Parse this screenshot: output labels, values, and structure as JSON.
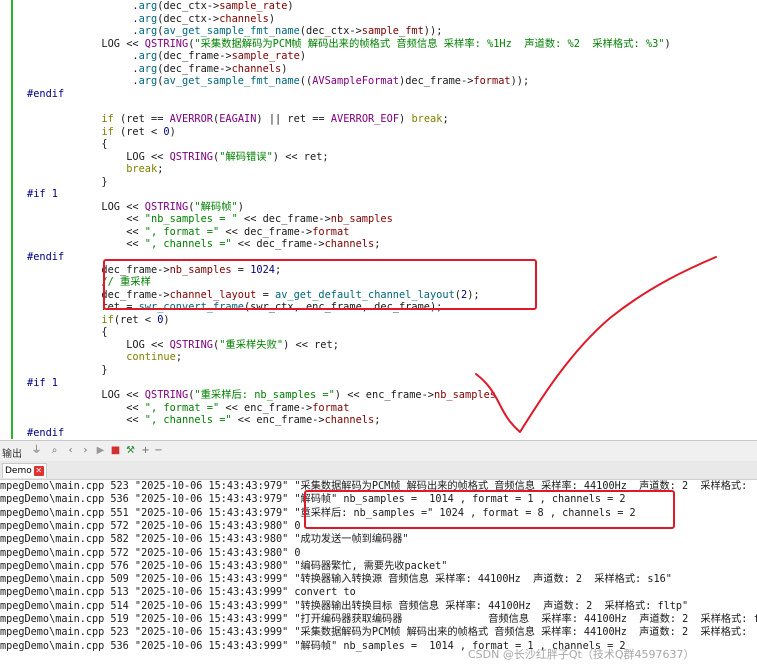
{
  "editor": {
    "lines": [
      [
        {
          "t": "                 ."
        },
        {
          "t": "arg",
          "c": "fn"
        },
        {
          "t": "(dec_ctx->"
        },
        {
          "t": "sample_rate",
          "c": "mem"
        },
        {
          "t": ")"
        }
      ],
      [
        {
          "t": "                 ."
        },
        {
          "t": "arg",
          "c": "fn"
        },
        {
          "t": "(dec_ctx->"
        },
        {
          "t": "channels",
          "c": "mem"
        },
        {
          "t": ")"
        }
      ],
      [
        {
          "t": "                 ."
        },
        {
          "t": "arg",
          "c": "fn"
        },
        {
          "t": "("
        },
        {
          "t": "av_get_sample_fmt_name",
          "c": "fn"
        },
        {
          "t": "(dec_ctx->"
        },
        {
          "t": "sample_fmt",
          "c": "mem"
        },
        {
          "t": "));"
        }
      ],
      [
        {
          "t": "            LOG << "
        },
        {
          "t": "QSTRING",
          "c": "mac"
        },
        {
          "t": "("
        },
        {
          "t": "\"采集数据解码为PCM帧 解码出来的帧格式 音频信息 采样率: %1Hz  声道数: %2  采样格式: %3\"",
          "c": "str"
        },
        {
          "t": ")"
        }
      ],
      [
        {
          "t": "                 ."
        },
        {
          "t": "arg",
          "c": "fn"
        },
        {
          "t": "(dec_frame->"
        },
        {
          "t": "sample_rate",
          "c": "mem"
        },
        {
          "t": ")"
        }
      ],
      [
        {
          "t": "                 ."
        },
        {
          "t": "arg",
          "c": "fn"
        },
        {
          "t": "(dec_frame->"
        },
        {
          "t": "channels",
          "c": "mem"
        },
        {
          "t": ")"
        }
      ],
      [
        {
          "t": "                 ."
        },
        {
          "t": "arg",
          "c": "fn"
        },
        {
          "t": "("
        },
        {
          "t": "av_get_sample_fmt_name",
          "c": "fn"
        },
        {
          "t": "(("
        },
        {
          "t": "AVSampleFormat",
          "c": "mac"
        },
        {
          "t": ")dec_frame->"
        },
        {
          "t": "format",
          "c": "mem"
        },
        {
          "t": "));"
        }
      ],
      [
        {
          "t": "#endif",
          "c": "pp"
        }
      ],
      [
        {
          "t": ""
        }
      ],
      [
        {
          "t": "            "
        },
        {
          "t": "if",
          "c": "kw"
        },
        {
          "t": " (ret == "
        },
        {
          "t": "AVERROR",
          "c": "mac"
        },
        {
          "t": "("
        },
        {
          "t": "EAGAIN",
          "c": "mac"
        },
        {
          "t": ") || ret == "
        },
        {
          "t": "AVERROR_EOF",
          "c": "mac"
        },
        {
          "t": ") "
        },
        {
          "t": "break",
          "c": "kw"
        },
        {
          "t": ";"
        }
      ],
      [
        {
          "t": "            "
        },
        {
          "t": "if",
          "c": "kw"
        },
        {
          "t": " (ret < "
        },
        {
          "t": "0",
          "c": "num"
        },
        {
          "t": ")"
        }
      ],
      [
        {
          "t": "            {"
        }
      ],
      [
        {
          "t": "                LOG << "
        },
        {
          "t": "QSTRING",
          "c": "mac"
        },
        {
          "t": "("
        },
        {
          "t": "\"解码错误\"",
          "c": "str"
        },
        {
          "t": ") << ret;"
        }
      ],
      [
        {
          "t": "                "
        },
        {
          "t": "break",
          "c": "kw"
        },
        {
          "t": ";"
        }
      ],
      [
        {
          "t": "            }"
        }
      ],
      [
        {
          "t": "#if 1",
          "c": "pp"
        }
      ],
      [
        {
          "t": "            LOG << "
        },
        {
          "t": "QSTRING",
          "c": "mac"
        },
        {
          "t": "("
        },
        {
          "t": "\"解码帧\"",
          "c": "str"
        },
        {
          "t": ")"
        }
      ],
      [
        {
          "t": "                << "
        },
        {
          "t": "\"nb_samples = \"",
          "c": "str"
        },
        {
          "t": " << dec_frame->"
        },
        {
          "t": "nb_samples",
          "c": "mem"
        }
      ],
      [
        {
          "t": "                << "
        },
        {
          "t": "\", format =\"",
          "c": "str"
        },
        {
          "t": " << dec_frame->"
        },
        {
          "t": "format",
          "c": "mem"
        }
      ],
      [
        {
          "t": "                << "
        },
        {
          "t": "\", channels =\"",
          "c": "str"
        },
        {
          "t": " << dec_frame->"
        },
        {
          "t": "channels",
          "c": "mem"
        },
        {
          "t": ";"
        }
      ],
      [
        {
          "t": "#endif",
          "c": "pp"
        }
      ],
      [
        {
          "t": "            dec_frame->"
        },
        {
          "t": "nb_samples",
          "c": "mem"
        },
        {
          "t": " = "
        },
        {
          "t": "1024",
          "c": "num"
        },
        {
          "t": ";"
        }
      ],
      [
        {
          "t": "            "
        },
        {
          "t": "// 重采样",
          "c": "cmt"
        }
      ],
      [
        {
          "t": "            dec_frame->"
        },
        {
          "t": "channel_layout",
          "c": "mem"
        },
        {
          "t": " = "
        },
        {
          "t": "av_get_default_channel_layout",
          "c": "fn"
        },
        {
          "t": "("
        },
        {
          "t": "2",
          "c": "num"
        },
        {
          "t": ");"
        }
      ],
      [
        {
          "t": "            ret = "
        },
        {
          "t": "swr_convert_frame",
          "c": "fn"
        },
        {
          "t": "(swr_ctx, enc_frame, dec_frame);"
        }
      ],
      [
        {
          "t": "            "
        },
        {
          "t": "if",
          "c": "kw"
        },
        {
          "t": "(ret < "
        },
        {
          "t": "0",
          "c": "num"
        },
        {
          "t": ")"
        }
      ],
      [
        {
          "t": "            {"
        }
      ],
      [
        {
          "t": "                LOG << "
        },
        {
          "t": "QSTRING",
          "c": "mac"
        },
        {
          "t": "("
        },
        {
          "t": "\"重采样失败\"",
          "c": "str"
        },
        {
          "t": ") << ret;"
        }
      ],
      [
        {
          "t": "                "
        },
        {
          "t": "continue",
          "c": "kw"
        },
        {
          "t": ";"
        }
      ],
      [
        {
          "t": "            }"
        }
      ],
      [
        {
          "t": "#if 1",
          "c": "pp"
        }
      ],
      [
        {
          "t": "            LOG << "
        },
        {
          "t": "QSTRING",
          "c": "mac"
        },
        {
          "t": "("
        },
        {
          "t": "\"重采样后: nb_samples =\"",
          "c": "str"
        },
        {
          "t": ") << enc_frame->"
        },
        {
          "t": "nb_samples",
          "c": "mem"
        }
      ],
      [
        {
          "t": "                << "
        },
        {
          "t": "\", format =\"",
          "c": "str"
        },
        {
          "t": " << enc_frame->"
        },
        {
          "t": "format",
          "c": "mem"
        }
      ],
      [
        {
          "t": "                << "
        },
        {
          "t": "\", channels =\"",
          "c": "str"
        },
        {
          "t": " << enc_frame->"
        },
        {
          "t": "channels",
          "c": "mem"
        },
        {
          "t": ";"
        }
      ],
      [
        {
          "t": "#endif",
          "c": "pp"
        }
      ]
    ]
  },
  "output_panel": {
    "title": "输出",
    "toolbar_icons": [
      "filter-icon",
      "search-icon",
      "up-icon",
      "down-icon",
      "run-icon",
      "stop-icon",
      "build-icon",
      "add-icon",
      "remove-icon"
    ],
    "tab_label": "Demo",
    "lines": [
      "mpegDemo\\main.cpp 523 \"2025-10-06 15:43:43:979\" \"采集数据解码为PCM帧 解码出来的帧格式 音频信息 采样率: 44100Hz  声道数: 2  采样格式: ",
      "mpegDemo\\main.cpp 536 \"2025-10-06 15:43:43:979\" \"解码帧\" nb_samples =  1014 , format = 1 , channels = 2",
      "mpegDemo\\main.cpp 551 \"2025-10-06 15:43:43:979\" \"重采样后: nb_samples =\" 1024 , format = 8 , channels = 2",
      "mpegDemo\\main.cpp 572 \"2025-10-06 15:43:43:980\" 0",
      "mpegDemo\\main.cpp 582 \"2025-10-06 15:43:43:980\" \"成功发送一帧到编码器\"",
      "mpegDemo\\main.cpp 572 \"2025-10-06 15:43:43:980\" 0",
      "mpegDemo\\main.cpp 576 \"2025-10-06 15:43:43:980\" \"编码器繁忙, 需要先收packet\"",
      "mpegDemo\\main.cpp 509 \"2025-10-06 15:43:43:999\" \"转换器输入转换源 音频信息 采样率: 44100Hz  声道数: 2  采样格式: s16\"",
      "mpegDemo\\main.cpp 513 \"2025-10-06 15:43:43:999\" convert to",
      "mpegDemo\\main.cpp 514 \"2025-10-06 15:43:43:999\" \"转换器输出转换目标 音频信息 采样率: 44100Hz  声道数: 2  采样格式: fltp\"",
      "mpegDemo\\main.cpp 519 \"2025-10-06 15:43:43:999\" \"打开编码器获取编码器              音频信息  采样率: 44100Hz  声道数: 2  采样格式: fl",
      "mpegDemo\\main.cpp 523 \"2025-10-06 15:43:43:999\" \"采集数据解码为PCM帧 解码出来的帧格式 音频信息 采样率: 44100Hz  声道数: 2  采样格式: ",
      "mpegDemo\\main.cpp 536 \"2025-10-06 15:43:43:999\" \"解码帧\" nb_samples =  1014 , format = 1 , channels = 2"
    ]
  },
  "watermark": "CSDN @长沙红胖子Qt（技术Q群4597637）",
  "colors": {
    "annotation": "#e0192a",
    "gutter": "#2bb52b"
  }
}
